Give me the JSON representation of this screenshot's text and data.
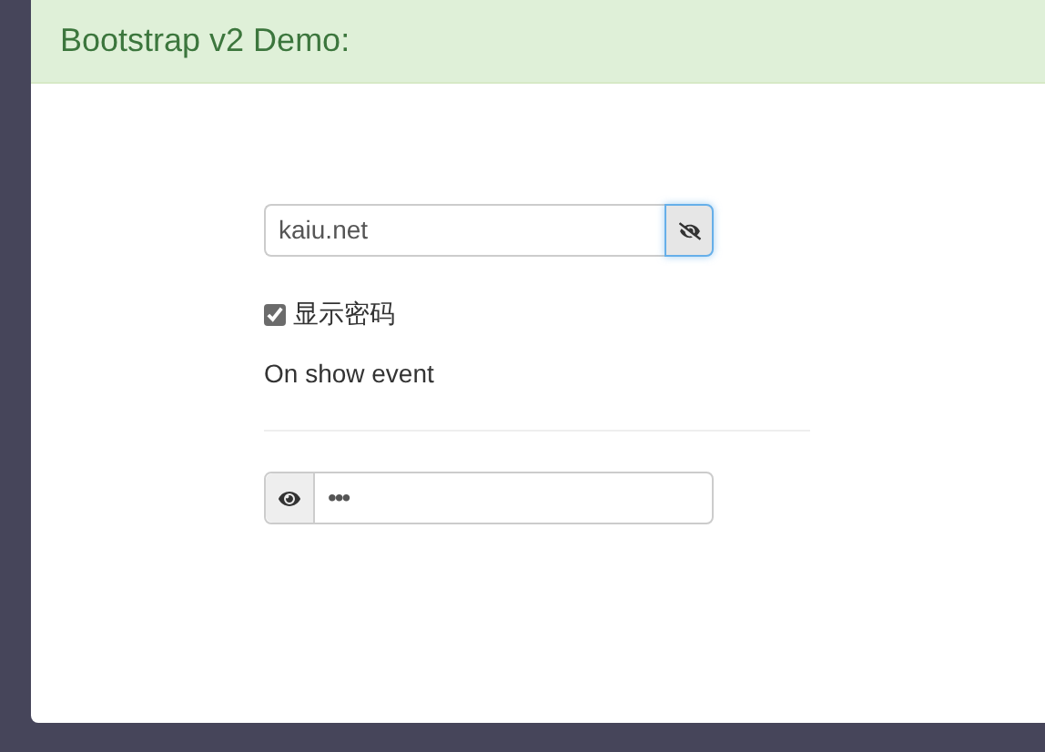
{
  "header": {
    "title": "Bootstrap v2 Demo:"
  },
  "password_field_1": {
    "value": "kaiu.net",
    "revealed": true,
    "kind": "append"
  },
  "show_password": {
    "label": "显示密码",
    "checked": true
  },
  "event_text": "On show event",
  "password_field_2": {
    "value": "•••",
    "revealed": false,
    "kind": "prepend"
  }
}
